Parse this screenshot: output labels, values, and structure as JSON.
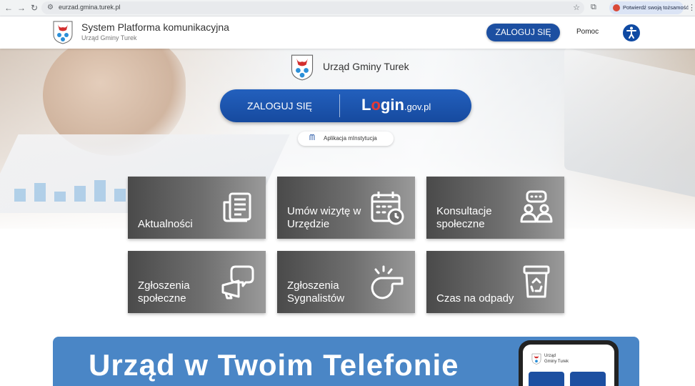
{
  "browser": {
    "url": "eurzad.gmina.turek.pl",
    "verify_label": "Potwierdź swoją tożsamość"
  },
  "header": {
    "title": "System Platforma komunikacyjna",
    "subtitle": "Urząd Gminy Turek",
    "login_label": "ZALOGUJ SIĘ",
    "help_label": "Pomoc"
  },
  "hero": {
    "office_name": "Urząd Gminy Turek",
    "login_label": "ZALOGUJ SIĘ",
    "login_gov_logo": {
      "l": "L",
      "o": "o",
      "gin": "gin",
      "gov": ".gov.pl"
    },
    "app_label": "Aplikacja mInstytucja"
  },
  "tiles": [
    {
      "label": "Aktualności",
      "icon": "news-icon"
    },
    {
      "label": "Umów wizytę w Urzędzie",
      "icon": "calendar-icon"
    },
    {
      "label": "Konsultacje społeczne",
      "icon": "consultation-icon"
    },
    {
      "label": "Zgłoszenia społeczne",
      "icon": "megaphone-icon"
    },
    {
      "label": "Zgłoszenia Sygnalistów",
      "icon": "whistle-icon"
    },
    {
      "label": "Czas na odpady",
      "icon": "recycle-bin-icon"
    }
  ],
  "banner": {
    "title": "Urząd w Twoim Telefonie",
    "phone_title_1": "Urząd",
    "phone_title_2": "Gminy Turek"
  },
  "colors": {
    "primary": "#1c4fa1",
    "banner": "#4a86c6",
    "tile_dark": "#4a4a4a"
  }
}
